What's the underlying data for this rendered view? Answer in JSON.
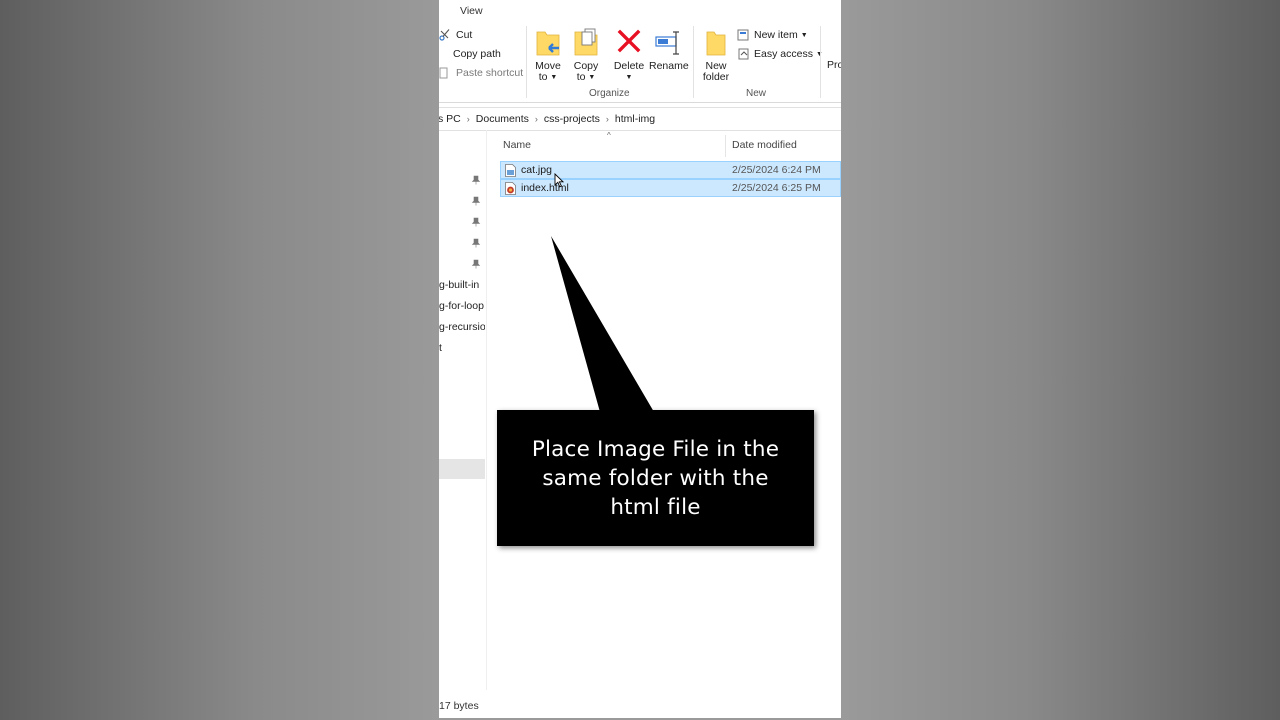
{
  "ribbon": {
    "tab_view": "View",
    "clipboard": {
      "cut": "Cut",
      "copy_path": "Copy path",
      "paste_shortcut": "Paste shortcut"
    },
    "organize": {
      "move_to": [
        "Move",
        "to"
      ],
      "copy_to": [
        "Copy",
        "to"
      ],
      "delete": "Delete",
      "rename": "Rename",
      "label": "Organize"
    },
    "new": {
      "new_folder": [
        "New",
        "folder"
      ],
      "new_item": "New item",
      "easy_access": "Easy access",
      "label": "New"
    },
    "properties_partial": "Pro"
  },
  "address": {
    "crumbs": [
      "s PC",
      "Documents",
      "css-projects",
      "html-img"
    ]
  },
  "nav": {
    "items": [
      "g-built-in",
      "g-for-loop",
      "g-recursion",
      "t"
    ]
  },
  "columns": {
    "name": "Name",
    "date_modified": "Date modified"
  },
  "files": [
    {
      "name": "cat.jpg",
      "date": "2/25/2024 6:24 PM",
      "icon": "image-file-icon"
    },
    {
      "name": "index.html",
      "date": "2/25/2024 6:25 PM",
      "icon": "html-file-icon"
    }
  ],
  "status": {
    "text": "17 bytes"
  },
  "callout": {
    "lines": [
      "Place Image File in the",
      "same folder with the",
      "html file"
    ]
  },
  "colors": {
    "selection_fill": "#cce8ff",
    "selection_border": "#99d1ff",
    "delete_red": "#e81123",
    "folder_yellow": "#ffd966"
  }
}
